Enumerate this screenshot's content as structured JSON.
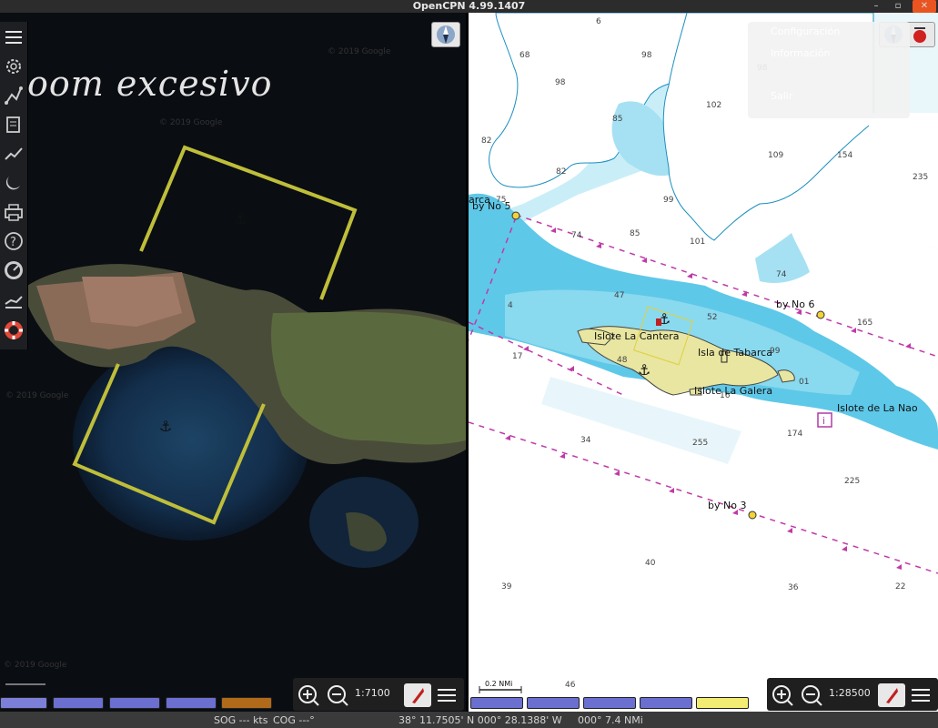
{
  "window": {
    "title": "OpenCPN 4.99.1407"
  },
  "left_chart": {
    "overlay_warning": "oom excesivo",
    "scale": "1:7100",
    "watermark": "© 2019 Google"
  },
  "right_chart": {
    "scale": "1:28500",
    "scale_bar_label": "0.2 NMi",
    "labels": {
      "byno5": "by No 5",
      "barca": "arca",
      "byno6": "by No 6",
      "byno3": "by No 3",
      "cantera": "Islote La Cantera",
      "tabarca": "Isla de Tabarca",
      "galera": "Islote La Galera",
      "nao": "Islote de La Nao"
    },
    "soundings": [
      {
        "t": "6"
      },
      {
        "t": "68"
      },
      {
        "t": "98"
      },
      {
        "t": "98"
      },
      {
        "t": "98"
      },
      {
        "t": "102"
      },
      {
        "t": "85"
      },
      {
        "t": "82"
      },
      {
        "t": "82"
      },
      {
        "t": "109"
      },
      {
        "t": "154"
      },
      {
        "t": "235"
      },
      {
        "t": "75"
      },
      {
        "t": "99"
      },
      {
        "t": "74"
      },
      {
        "t": "85"
      },
      {
        "t": "101"
      },
      {
        "t": "74"
      },
      {
        "t": "47"
      },
      {
        "t": "4"
      },
      {
        "t": "52"
      },
      {
        "t": "165"
      },
      {
        "t": "17"
      },
      {
        "t": "48"
      },
      {
        "t": "99"
      },
      {
        "t": "01"
      },
      {
        "t": "16"
      },
      {
        "t": "34"
      },
      {
        "t": "255"
      },
      {
        "t": "174"
      },
      {
        "t": "225"
      },
      {
        "t": "40"
      },
      {
        "t": "39"
      },
      {
        "t": "36"
      },
      {
        "t": "22"
      },
      {
        "t": "46"
      }
    ]
  },
  "menu": {
    "items": [
      "Configuración",
      "Información",
      "Salir"
    ]
  },
  "status": {
    "sog": "SOG --- kts",
    "cog": "COG ---°",
    "position": "38° 11.7505' N   000° 28.1388' W",
    "bearing": "000° 7.4 NMi"
  },
  "toolbar": {
    "icons": [
      "menu-icon",
      "settings-icon",
      "route-icon",
      "documents-icon",
      "track-icon",
      "tide-icon",
      "print-icon",
      "help-icon",
      "dashboard-icon",
      "ais-icon",
      "mob-icon"
    ]
  },
  "colors": {
    "chart_land": "#e8e6a0",
    "chart_shallow": "#5ec8e8",
    "chart_water": "#ffffff",
    "pill_blue": "#6b6fcf",
    "pill_yellow": "#f2ec72",
    "pill_brown": "#b06a1a",
    "satellite_boundary": "#bfbe3a"
  }
}
